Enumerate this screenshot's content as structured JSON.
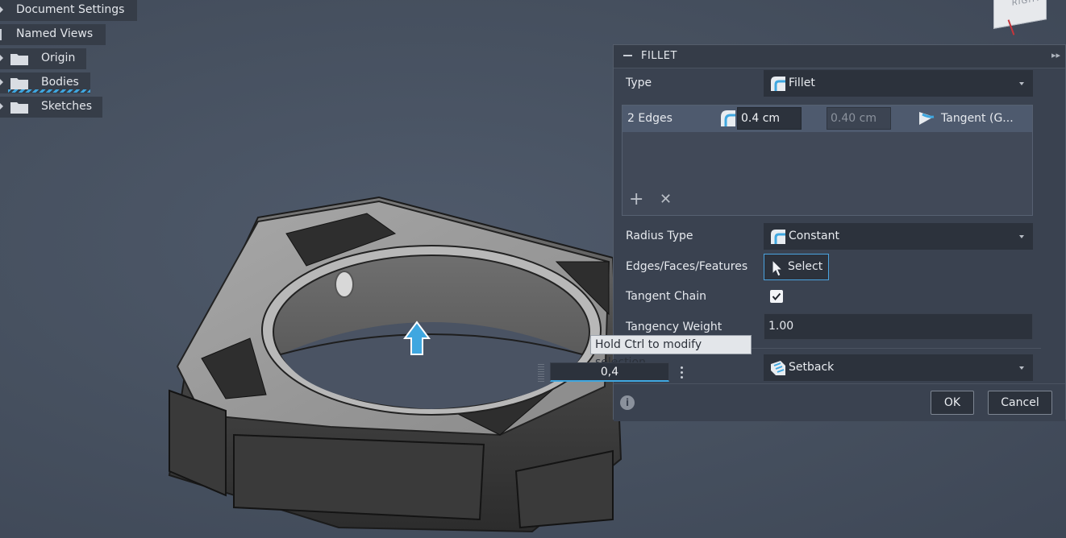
{
  "browser": {
    "items": [
      {
        "label": "Document Settings"
      },
      {
        "label": "Named Views"
      },
      {
        "label": "Origin"
      },
      {
        "label": "Bodies"
      },
      {
        "label": "Sketches"
      }
    ]
  },
  "viewcube": {
    "face_label": "RIGHT"
  },
  "fillet": {
    "title": "FILLET",
    "type_label": "Type",
    "type_value": "Fillet",
    "edges_row": {
      "label": "2 Edges",
      "radius": "0.4 cm",
      "radius2": "0.40 cm",
      "continuity": "Tangent (G..."
    },
    "radius_type_label": "Radius Type",
    "radius_type_value": "Constant",
    "edges_faces_label": "Edges/Faces/Features",
    "select_label": "Select",
    "tangent_chain_label": "Tangent Chain",
    "tangent_chain_checked": true,
    "tangency_weight_label": "Tangency Weight",
    "tangency_weight_value": "1.00",
    "corner_type_value": "Setback",
    "ok_label": "OK",
    "cancel_label": "Cancel"
  },
  "tooltip": {
    "text": "Hold Ctrl to modify selection"
  },
  "heads_up_input": {
    "value": "0,4"
  },
  "colors": {
    "accent": "#3fa7e0",
    "panel_bg": "#3a4250",
    "viewport_bg": "#4a5363",
    "selected_row": "#4e5a6e"
  }
}
